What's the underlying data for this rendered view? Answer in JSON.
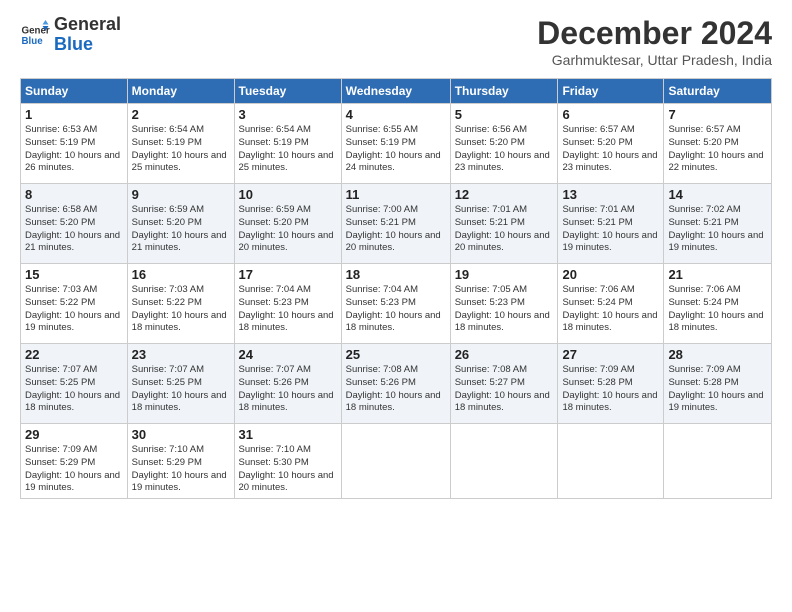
{
  "header": {
    "logo_line1": "General",
    "logo_line2": "Blue",
    "month_year": "December 2024",
    "location": "Garhmuktesar, Uttar Pradesh, India"
  },
  "weekdays": [
    "Sunday",
    "Monday",
    "Tuesday",
    "Wednesday",
    "Thursday",
    "Friday",
    "Saturday"
  ],
  "weeks": [
    [
      {
        "day": "1",
        "sunrise": "6:53 AM",
        "sunset": "5:19 PM",
        "daylight": "10 hours and 26 minutes."
      },
      {
        "day": "2",
        "sunrise": "6:54 AM",
        "sunset": "5:19 PM",
        "daylight": "10 hours and 25 minutes."
      },
      {
        "day": "3",
        "sunrise": "6:54 AM",
        "sunset": "5:19 PM",
        "daylight": "10 hours and 25 minutes."
      },
      {
        "day": "4",
        "sunrise": "6:55 AM",
        "sunset": "5:19 PM",
        "daylight": "10 hours and 24 minutes."
      },
      {
        "day": "5",
        "sunrise": "6:56 AM",
        "sunset": "5:20 PM",
        "daylight": "10 hours and 23 minutes."
      },
      {
        "day": "6",
        "sunrise": "6:57 AM",
        "sunset": "5:20 PM",
        "daylight": "10 hours and 23 minutes."
      },
      {
        "day": "7",
        "sunrise": "6:57 AM",
        "sunset": "5:20 PM",
        "daylight": "10 hours and 22 minutes."
      }
    ],
    [
      {
        "day": "8",
        "sunrise": "6:58 AM",
        "sunset": "5:20 PM",
        "daylight": "10 hours and 21 minutes."
      },
      {
        "day": "9",
        "sunrise": "6:59 AM",
        "sunset": "5:20 PM",
        "daylight": "10 hours and 21 minutes."
      },
      {
        "day": "10",
        "sunrise": "6:59 AM",
        "sunset": "5:20 PM",
        "daylight": "10 hours and 20 minutes."
      },
      {
        "day": "11",
        "sunrise": "7:00 AM",
        "sunset": "5:21 PM",
        "daylight": "10 hours and 20 minutes."
      },
      {
        "day": "12",
        "sunrise": "7:01 AM",
        "sunset": "5:21 PM",
        "daylight": "10 hours and 20 minutes."
      },
      {
        "day": "13",
        "sunrise": "7:01 AM",
        "sunset": "5:21 PM",
        "daylight": "10 hours and 19 minutes."
      },
      {
        "day": "14",
        "sunrise": "7:02 AM",
        "sunset": "5:21 PM",
        "daylight": "10 hours and 19 minutes."
      }
    ],
    [
      {
        "day": "15",
        "sunrise": "7:03 AM",
        "sunset": "5:22 PM",
        "daylight": "10 hours and 19 minutes."
      },
      {
        "day": "16",
        "sunrise": "7:03 AM",
        "sunset": "5:22 PM",
        "daylight": "10 hours and 18 minutes."
      },
      {
        "day": "17",
        "sunrise": "7:04 AM",
        "sunset": "5:23 PM",
        "daylight": "10 hours and 18 minutes."
      },
      {
        "day": "18",
        "sunrise": "7:04 AM",
        "sunset": "5:23 PM",
        "daylight": "10 hours and 18 minutes."
      },
      {
        "day": "19",
        "sunrise": "7:05 AM",
        "sunset": "5:23 PM",
        "daylight": "10 hours and 18 minutes."
      },
      {
        "day": "20",
        "sunrise": "7:06 AM",
        "sunset": "5:24 PM",
        "daylight": "10 hours and 18 minutes."
      },
      {
        "day": "21",
        "sunrise": "7:06 AM",
        "sunset": "5:24 PM",
        "daylight": "10 hours and 18 minutes."
      }
    ],
    [
      {
        "day": "22",
        "sunrise": "7:07 AM",
        "sunset": "5:25 PM",
        "daylight": "10 hours and 18 minutes."
      },
      {
        "day": "23",
        "sunrise": "7:07 AM",
        "sunset": "5:25 PM",
        "daylight": "10 hours and 18 minutes."
      },
      {
        "day": "24",
        "sunrise": "7:07 AM",
        "sunset": "5:26 PM",
        "daylight": "10 hours and 18 minutes."
      },
      {
        "day": "25",
        "sunrise": "7:08 AM",
        "sunset": "5:26 PM",
        "daylight": "10 hours and 18 minutes."
      },
      {
        "day": "26",
        "sunrise": "7:08 AM",
        "sunset": "5:27 PM",
        "daylight": "10 hours and 18 minutes."
      },
      {
        "day": "27",
        "sunrise": "7:09 AM",
        "sunset": "5:28 PM",
        "daylight": "10 hours and 18 minutes."
      },
      {
        "day": "28",
        "sunrise": "7:09 AM",
        "sunset": "5:28 PM",
        "daylight": "10 hours and 19 minutes."
      }
    ],
    [
      {
        "day": "29",
        "sunrise": "7:09 AM",
        "sunset": "5:29 PM",
        "daylight": "10 hours and 19 minutes."
      },
      {
        "day": "30",
        "sunrise": "7:10 AM",
        "sunset": "5:29 PM",
        "daylight": "10 hours and 19 minutes."
      },
      {
        "day": "31",
        "sunrise": "7:10 AM",
        "sunset": "5:30 PM",
        "daylight": "10 hours and 20 minutes."
      },
      null,
      null,
      null,
      null
    ]
  ]
}
